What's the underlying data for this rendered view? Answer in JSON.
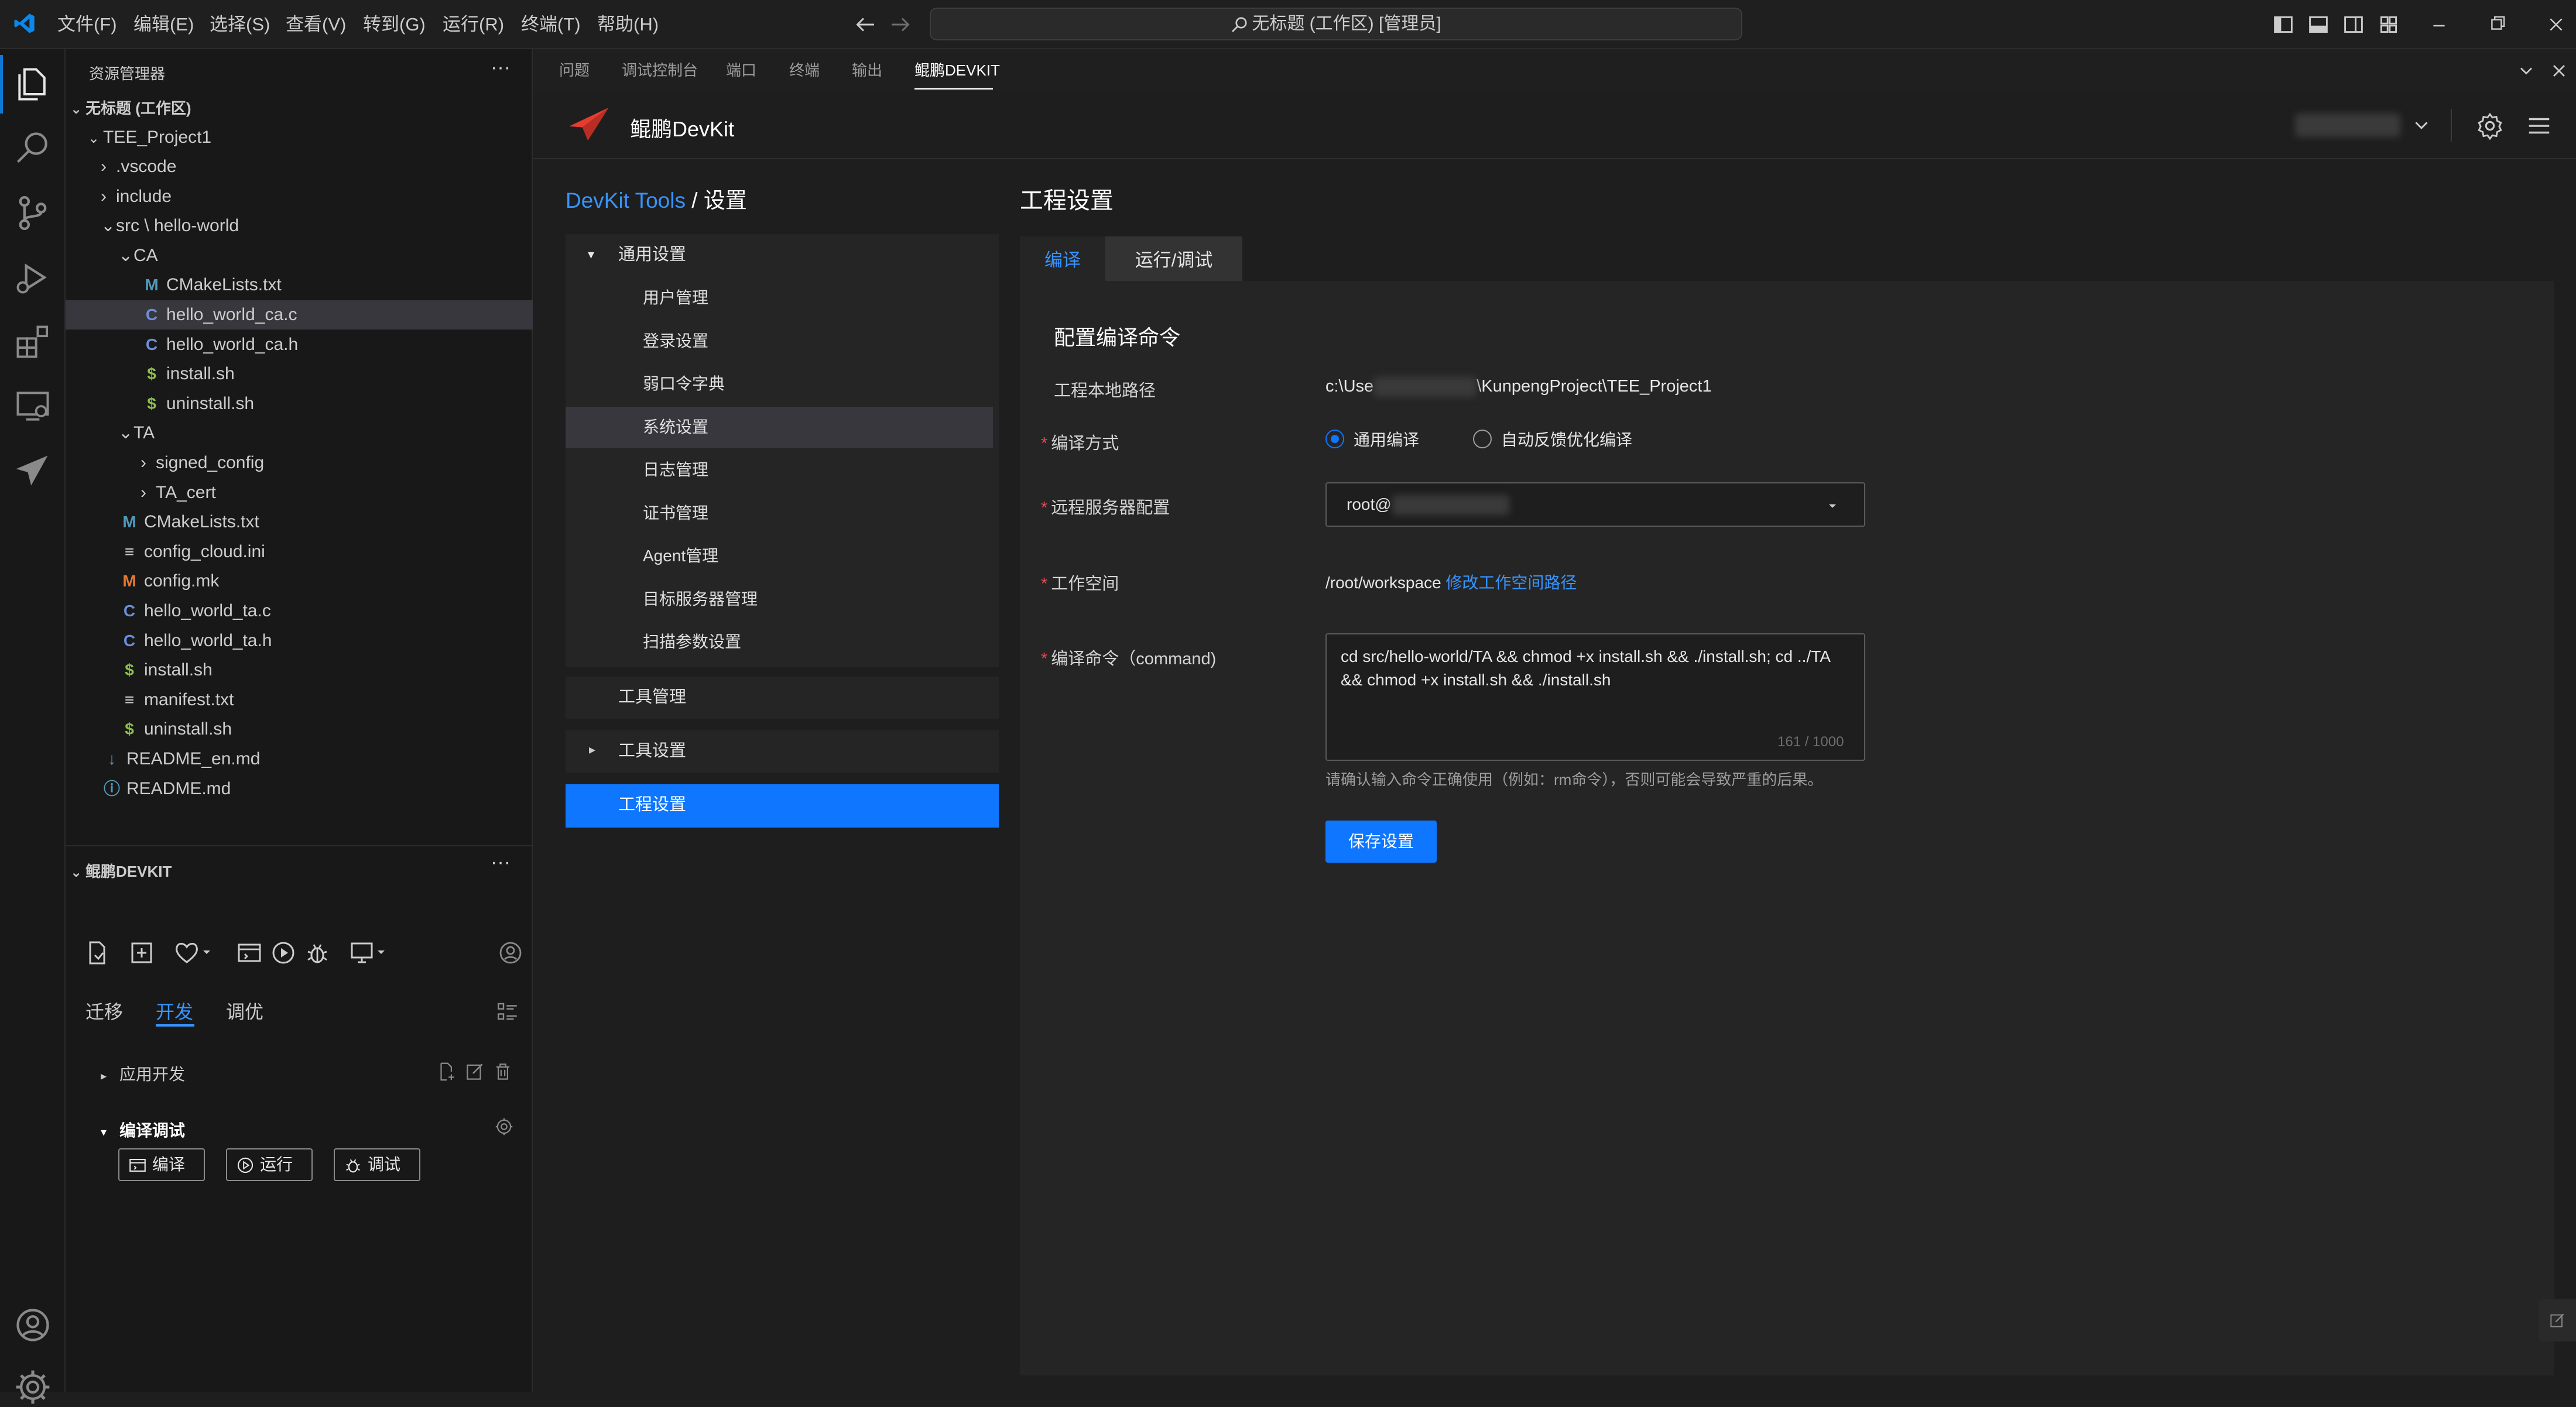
{
  "titlebar": {
    "menus": [
      "文件(F)",
      "编辑(E)",
      "选择(S)",
      "查看(V)",
      "转到(G)",
      "运行(R)",
      "终端(T)",
      "帮助(H)"
    ],
    "search_text": "无标题 (工作区) [管理员]"
  },
  "explorer": {
    "title": "资源管理器",
    "workspace": "无标题 (工作区)",
    "project": "TEE_Project1",
    "items": [
      {
        "label": ".vscode",
        "icon": "chevron-right"
      },
      {
        "label": "include",
        "icon": "chevron-right"
      },
      {
        "label": "src \\ hello-world",
        "icon": "chevron-down"
      },
      {
        "label": "CA",
        "icon": "chevron-down"
      },
      {
        "label": "CMakeLists.txt",
        "icon": "M"
      },
      {
        "label": "hello_world_ca.c",
        "icon": "C"
      },
      {
        "label": "hello_world_ca.h",
        "icon": "C"
      },
      {
        "label": "install.sh",
        "icon": "$"
      },
      {
        "label": "uninstall.sh",
        "icon": "$"
      },
      {
        "label": "TA",
        "icon": "chevron-down"
      },
      {
        "label": "signed_config",
        "icon": "chevron-right"
      },
      {
        "label": "TA_cert",
        "icon": "chevron-right"
      },
      {
        "label": "CMakeLists.txt",
        "icon": "M"
      },
      {
        "label": "config_cloud.ini",
        "icon": "≡"
      },
      {
        "label": "config.mk",
        "icon": "M"
      },
      {
        "label": "hello_world_ta.c",
        "icon": "C"
      },
      {
        "label": "hello_world_ta.h",
        "icon": "C"
      },
      {
        "label": "install.sh",
        "icon": "$"
      },
      {
        "label": "manifest.txt",
        "icon": "≡"
      },
      {
        "label": "uninstall.sh",
        "icon": "$"
      },
      {
        "label": "README_en.md",
        "icon": "↓"
      },
      {
        "label": "README.md",
        "icon": "ⓘ"
      }
    ]
  },
  "devkit_panel": {
    "title": "鲲鹏DEVKIT",
    "tabs": [
      "迁移",
      "开发",
      "调优"
    ],
    "section_app": "应用开发",
    "section_build": "编译调试",
    "buttons": {
      "compile": "编译",
      "run": "运行",
      "debug": "调试"
    }
  },
  "panel_tabs": [
    "问题",
    "调试控制台",
    "端口",
    "终端",
    "输出",
    "鲲鹏DEVKIT"
  ],
  "devkit": {
    "brand": "鲲鹏DevKit",
    "breadcrumb_link": "DevKit Tools",
    "breadcrumb_sep": " / ",
    "breadcrumb_current": "设置",
    "nav": {
      "general": "通用设置",
      "sub": [
        "用户管理",
        "登录设置",
        "弱口令字典",
        "系统设置",
        "日志管理",
        "证书管理",
        "Agent管理",
        "目标服务器管理",
        "扫描参数设置"
      ],
      "tools_mgmt": "工具管理",
      "tools_settings": "工具设置",
      "project_settings": "工程设置"
    },
    "page_title": "工程设置",
    "tabs": [
      "编译",
      "运行/调试"
    ],
    "section_title": "配置编译命令",
    "form": {
      "path_label": "工程本地路径",
      "path_prefix": "c:\\Use",
      "path_suffix": "\\KunpengProject\\TEE_Project1",
      "mode_label": "编译方式",
      "mode_options": [
        "通用编译",
        "自动反馈优化编译"
      ],
      "mode_selected": "通用编译",
      "server_label": "远程服务器配置",
      "server_value": "root@",
      "workspace_label": "工作空间",
      "workspace_value": "/root/workspace",
      "workspace_link": "修改工作空间路径",
      "command_label": "编译命令（command)",
      "command_value": "cd src/hello-world/TA && chmod +x install.sh && ./install.sh; cd ../TA && chmod +x install.sh && ./install.sh",
      "command_counter": "161 / 1000",
      "hint": "请确认输入命令正确使用（例如：rm命令），否则可能会导致严重的后果。",
      "save_button": "保存设置"
    }
  },
  "colors": {
    "accent": "#0e76ff",
    "link": "#3794ff",
    "required": "#e5484d"
  }
}
